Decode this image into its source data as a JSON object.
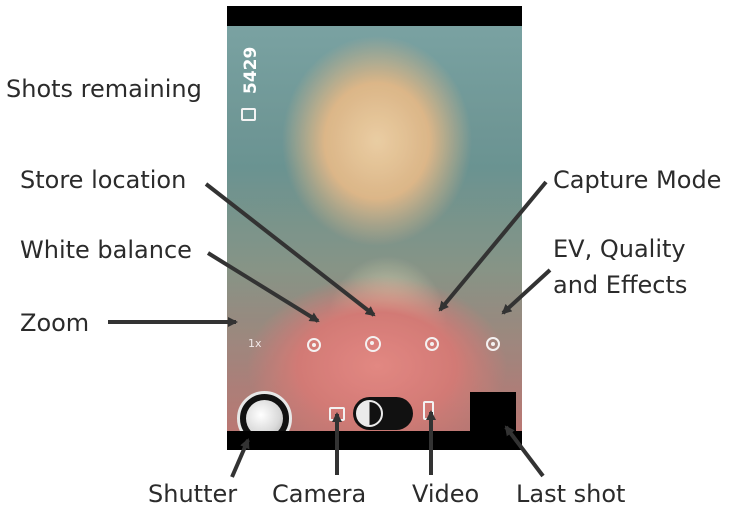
{
  "shots_remaining_count": "5429",
  "zoom_level": "1x",
  "annotations": {
    "shots_remaining": "Shots remaining",
    "store_location": "Store location",
    "white_balance": "White balance",
    "zoom": "Zoom",
    "capture_mode": "Capture Mode",
    "ev_line1": "EV, Quality",
    "ev_line2": "and Effects",
    "shutter": "Shutter",
    "camera": "Camera",
    "video": "Video",
    "last_shot": "Last shot"
  },
  "icons": {
    "shots_counter": "camera-icon",
    "white_balance": "white-balance-icon",
    "store_location": "location-off-icon",
    "capture_mode": "capture-mode-icon",
    "settings": "settings-icon",
    "shutter": "aperture-icon",
    "camera_mode": "camera-icon",
    "video_mode": "video-icon"
  },
  "colors": {
    "label_text": "#2b2b2b",
    "arrow": "#333333",
    "frame": "#000000"
  }
}
